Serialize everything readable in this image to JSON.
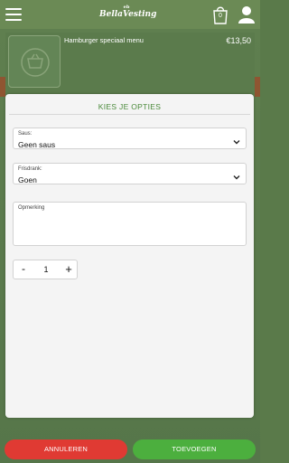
{
  "header": {
    "logo_small": "eb",
    "logo_text": "BellaVesting",
    "cart_count": "0"
  },
  "product": {
    "name": "Hamburger speciaal menu",
    "price": "€13,50"
  },
  "options": {
    "title": "KIES JE OPTIES",
    "saus_label": "Saus:",
    "saus_value": "Geen saus",
    "drank_label": "Frisdrank:",
    "drank_value": "Goen",
    "remark_label": "Opmerking",
    "remark_value": "",
    "qty_minus": "-",
    "qty_value": "1",
    "qty_plus": "+"
  },
  "footer": {
    "cancel_label": "ANNULEREN",
    "add_label": "TOEVOEGEN"
  },
  "colors": {
    "cancel": "#e03a33",
    "add": "#4caf3e",
    "title": "#4a8a3a"
  }
}
